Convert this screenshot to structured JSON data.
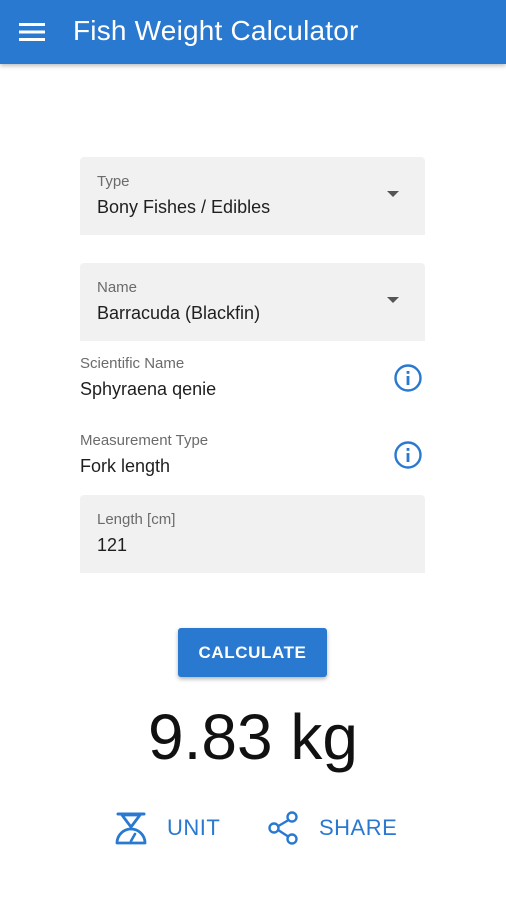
{
  "app": {
    "title": "Fish Weight Calculator"
  },
  "toolbar": {
    "menu_icon": "hamburger-menu-icon"
  },
  "form": {
    "type": {
      "label": "Type",
      "value": "Bony Fishes / Edibles"
    },
    "name": {
      "label": "Name",
      "value": "Barracuda (Blackfin)"
    },
    "scientific_name": {
      "label": "Scientific Name",
      "value": "Sphyraena qenie"
    },
    "measurement_type": {
      "label": "Measurement Type",
      "value": "Fork length"
    },
    "length": {
      "label": "Length [cm]",
      "value": "121"
    }
  },
  "calculate_label": "CALCULATE",
  "result": "9.83 kg",
  "actions": {
    "unit": {
      "label": "UNIT",
      "icon": "scale-icon"
    },
    "share": {
      "label": "SHARE",
      "icon": "share-icon"
    }
  },
  "colors": {
    "accent": "#2979d0"
  }
}
